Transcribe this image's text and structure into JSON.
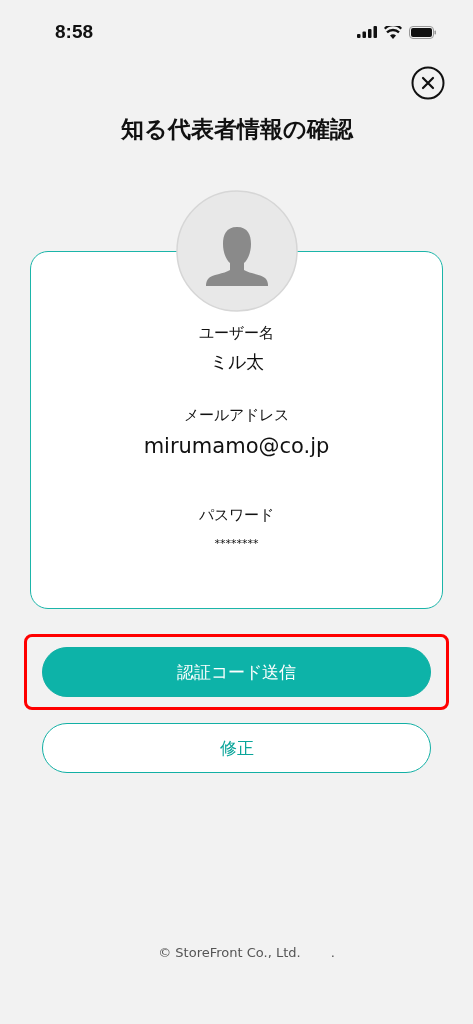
{
  "status_bar": {
    "time": "8:58"
  },
  "title": "知る代表者情報の確認",
  "fields": [
    {
      "label": "ユーザー名",
      "value": "ミル太",
      "kind": "name"
    },
    {
      "label": "メールアドレス",
      "value": "mirumamo@co.jp",
      "kind": "email"
    },
    {
      "label": "パスワード",
      "value": "********",
      "kind": "password"
    }
  ],
  "buttons": [
    {
      "label": "認証コード送信",
      "kind": "primary",
      "highlighted": true
    },
    {
      "label": "修正",
      "kind": "secondary",
      "highlighted": false
    }
  ],
  "footer": {
    "copyright": "© StoreFront Co., Ltd.",
    "mark": "."
  }
}
